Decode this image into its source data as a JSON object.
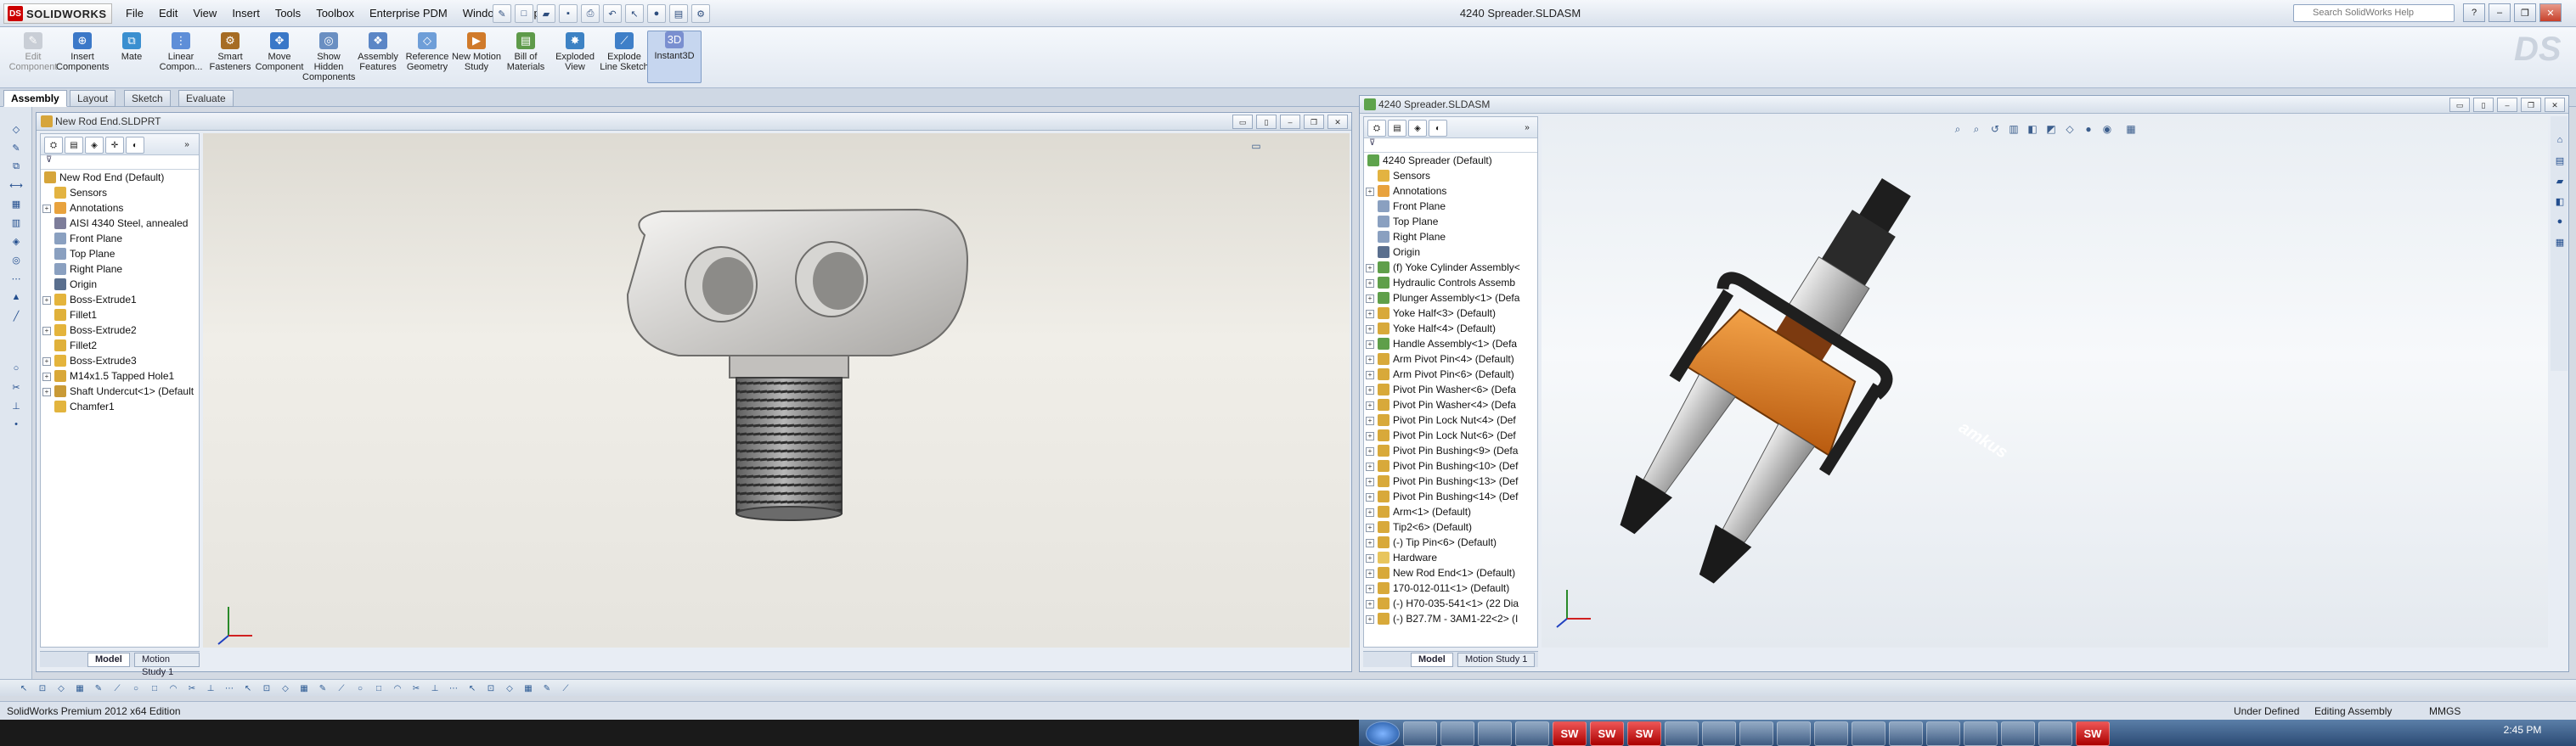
{
  "app": {
    "logo_text": "SOLIDWORKS",
    "logo_ds": "DS",
    "window_title": "4240 Spreader.SLDASM"
  },
  "menu": [
    "File",
    "Edit",
    "View",
    "Insert",
    "Tools",
    "Toolbox",
    "Enterprise PDM",
    "Window",
    "Help"
  ],
  "search": {
    "placeholder": "Search SolidWorks Help"
  },
  "commands": [
    {
      "label": "Edit Component",
      "icon": "edit-component-icon",
      "enabled": false
    },
    {
      "label": "Insert Components",
      "icon": "insert-components-icon",
      "enabled": true
    },
    {
      "label": "Mate",
      "icon": "mate-icon",
      "enabled": true
    },
    {
      "label": "Linear Compon...",
      "icon": "linear-pattern-icon",
      "enabled": true
    },
    {
      "label": "Smart Fasteners",
      "icon": "smart-fasteners-icon",
      "enabled": true
    },
    {
      "label": "Move Component",
      "icon": "move-component-icon",
      "enabled": true
    },
    {
      "label": "Show Hidden Components",
      "icon": "show-hidden-icon",
      "enabled": true
    },
    {
      "label": "Assembly Features",
      "icon": "assembly-features-icon",
      "enabled": true
    },
    {
      "label": "Reference Geometry",
      "icon": "reference-geometry-icon",
      "enabled": true
    },
    {
      "label": "New Motion Study",
      "icon": "motion-study-icon",
      "enabled": true
    },
    {
      "label": "Bill of Materials",
      "icon": "bom-icon",
      "enabled": true
    },
    {
      "label": "Exploded View",
      "icon": "exploded-view-icon",
      "enabled": true
    },
    {
      "label": "Explode Line Sketch",
      "icon": "explode-line-icon",
      "enabled": true
    },
    {
      "label": "Instant3D",
      "icon": "instant3d-icon",
      "enabled": true,
      "active": true
    }
  ],
  "command_tabs": [
    {
      "label": "Assembly",
      "active": true
    },
    {
      "label": "Layout",
      "active": false
    },
    {
      "label": "Sketch",
      "active": false
    },
    {
      "label": "Evaluate",
      "active": false
    }
  ],
  "part_window": {
    "title": "New Rod End.SLDPRT",
    "tree": [
      {
        "label": "New Rod End  (Default)",
        "icon": "part-icon",
        "root": true
      },
      {
        "label": "Sensors",
        "icon": "sensors-icon"
      },
      {
        "label": "Annotations",
        "icon": "annotations-icon",
        "expandable": true
      },
      {
        "label": "AISI 4340 Steel, annealed",
        "icon": "material-icon"
      },
      {
        "label": "Front Plane",
        "icon": "plane-icon"
      },
      {
        "label": "Top Plane",
        "icon": "plane-icon"
      },
      {
        "label": "Right Plane",
        "icon": "plane-icon"
      },
      {
        "label": "Origin",
        "icon": "origin-icon"
      },
      {
        "label": "Boss-Extrude1",
        "icon": "extrude-icon",
        "expandable": true
      },
      {
        "label": "Fillet1",
        "icon": "fillet-icon"
      },
      {
        "label": "Boss-Extrude2",
        "icon": "extrude-icon",
        "expandable": true
      },
      {
        "label": "Fillet2",
        "icon": "fillet-icon"
      },
      {
        "label": "Boss-Extrude3",
        "icon": "extrude-icon",
        "expandable": true
      },
      {
        "label": "M14x1.5 Tapped Hole1",
        "icon": "hole-icon",
        "expandable": true
      },
      {
        "label": "Shaft Undercut<1> (Default",
        "icon": "library-feature-icon",
        "expandable": true
      },
      {
        "label": "Chamfer1",
        "icon": "chamfer-icon"
      }
    ],
    "bottom_tabs": [
      {
        "label": "Model",
        "active": true
      },
      {
        "label": "Motion Study 1",
        "active": false
      }
    ]
  },
  "assembly_window": {
    "title": "4240 Spreader.SLDASM",
    "tree": [
      {
        "label": "4240 Spreader  (Default)",
        "icon": "assembly-icon",
        "root": true
      },
      {
        "label": "Sensors",
        "icon": "sensors-icon"
      },
      {
        "label": "Annotations",
        "icon": "annotations-icon",
        "expandable": true
      },
      {
        "label": "Front Plane",
        "icon": "plane-icon"
      },
      {
        "label": "Top Plane",
        "icon": "plane-icon"
      },
      {
        "label": "Right Plane",
        "icon": "plane-icon"
      },
      {
        "label": "Origin",
        "icon": "origin-icon"
      },
      {
        "label": "(f) Yoke Cylinder Assembly<",
        "icon": "subassembly-icon",
        "expandable": true
      },
      {
        "label": "Hydraulic Controls Assemb",
        "icon": "subassembly-icon",
        "expandable": true
      },
      {
        "label": "Plunger Assembly<1> (Defa",
        "icon": "subassembly-icon",
        "expandable": true
      },
      {
        "label": "Yoke Half<3> (Default)",
        "icon": "component-icon",
        "expandable": true
      },
      {
        "label": "Yoke Half<4> (Default)",
        "icon": "component-icon",
        "expandable": true
      },
      {
        "label": "Handle Assembly<1> (Defa",
        "icon": "subassembly-icon",
        "expandable": true
      },
      {
        "label": "Arm Pivot Pin<4> (Default)",
        "icon": "component-icon",
        "expandable": true
      },
      {
        "label": "Arm Pivot Pin<6> (Default)",
        "icon": "component-icon",
        "expandable": true
      },
      {
        "label": "Pivot Pin Washer<6> (Defa",
        "icon": "component-icon",
        "expandable": true
      },
      {
        "label": "Pivot Pin Washer<4> (Defa",
        "icon": "component-icon",
        "expandable": true
      },
      {
        "label": "Pivot Pin Lock Nut<4> (Def",
        "icon": "component-icon",
        "expandable": true
      },
      {
        "label": "Pivot Pin Lock Nut<6> (Def",
        "icon": "component-icon",
        "expandable": true
      },
      {
        "label": "Pivot Pin Bushing<9> (Defa",
        "icon": "component-icon",
        "expandable": true
      },
      {
        "label": "Pivot Pin Bushing<10> (Def",
        "icon": "component-icon",
        "expandable": true
      },
      {
        "label": "Pivot Pin Bushing<13> (Def",
        "icon": "component-icon",
        "expandable": true
      },
      {
        "label": "Pivot Pin Bushing<14> (Def",
        "icon": "component-icon",
        "expandable": true
      },
      {
        "label": "Arm<1> (Default)",
        "icon": "component-icon",
        "expandable": true
      },
      {
        "label": "Tip2<6> (Default)",
        "icon": "component-icon",
        "expandable": true
      },
      {
        "label": "(-) Tip Pin<6> (Default)",
        "icon": "component-icon",
        "expandable": true
      },
      {
        "label": "Hardware",
        "icon": "folder-icon",
        "expandable": true
      },
      {
        "label": "New Rod End<1> (Default)",
        "icon": "component-icon",
        "expandable": true
      },
      {
        "label": "170-012-011<1> (Default)",
        "icon": "component-icon",
        "expandable": true
      },
      {
        "label": "(-) H70-035-541<1> (22 Dia",
        "icon": "component-icon",
        "expandable": true
      },
      {
        "label": "(-) B27.7M - 3AM1-22<2> (I",
        "icon": "component-icon",
        "expandable": true
      }
    ],
    "bottom_tabs": [
      {
        "label": "Model",
        "active": true
      },
      {
        "label": "Motion Study 1",
        "active": false
      }
    ],
    "brand_text": "amkus"
  },
  "status": {
    "left": "SolidWorks Premium 2012 x64 Edition",
    "state": "Under Defined",
    "mode": "Editing Assembly",
    "units": "MMGS"
  },
  "taskbar": {
    "time": "2:45 PM",
    "sw_label": "SW"
  },
  "colors": {
    "accent": "#c00000",
    "selection_blue": "#c6d6ef",
    "tree_bg": "#ffffff",
    "orange_part": "#e2801f"
  }
}
